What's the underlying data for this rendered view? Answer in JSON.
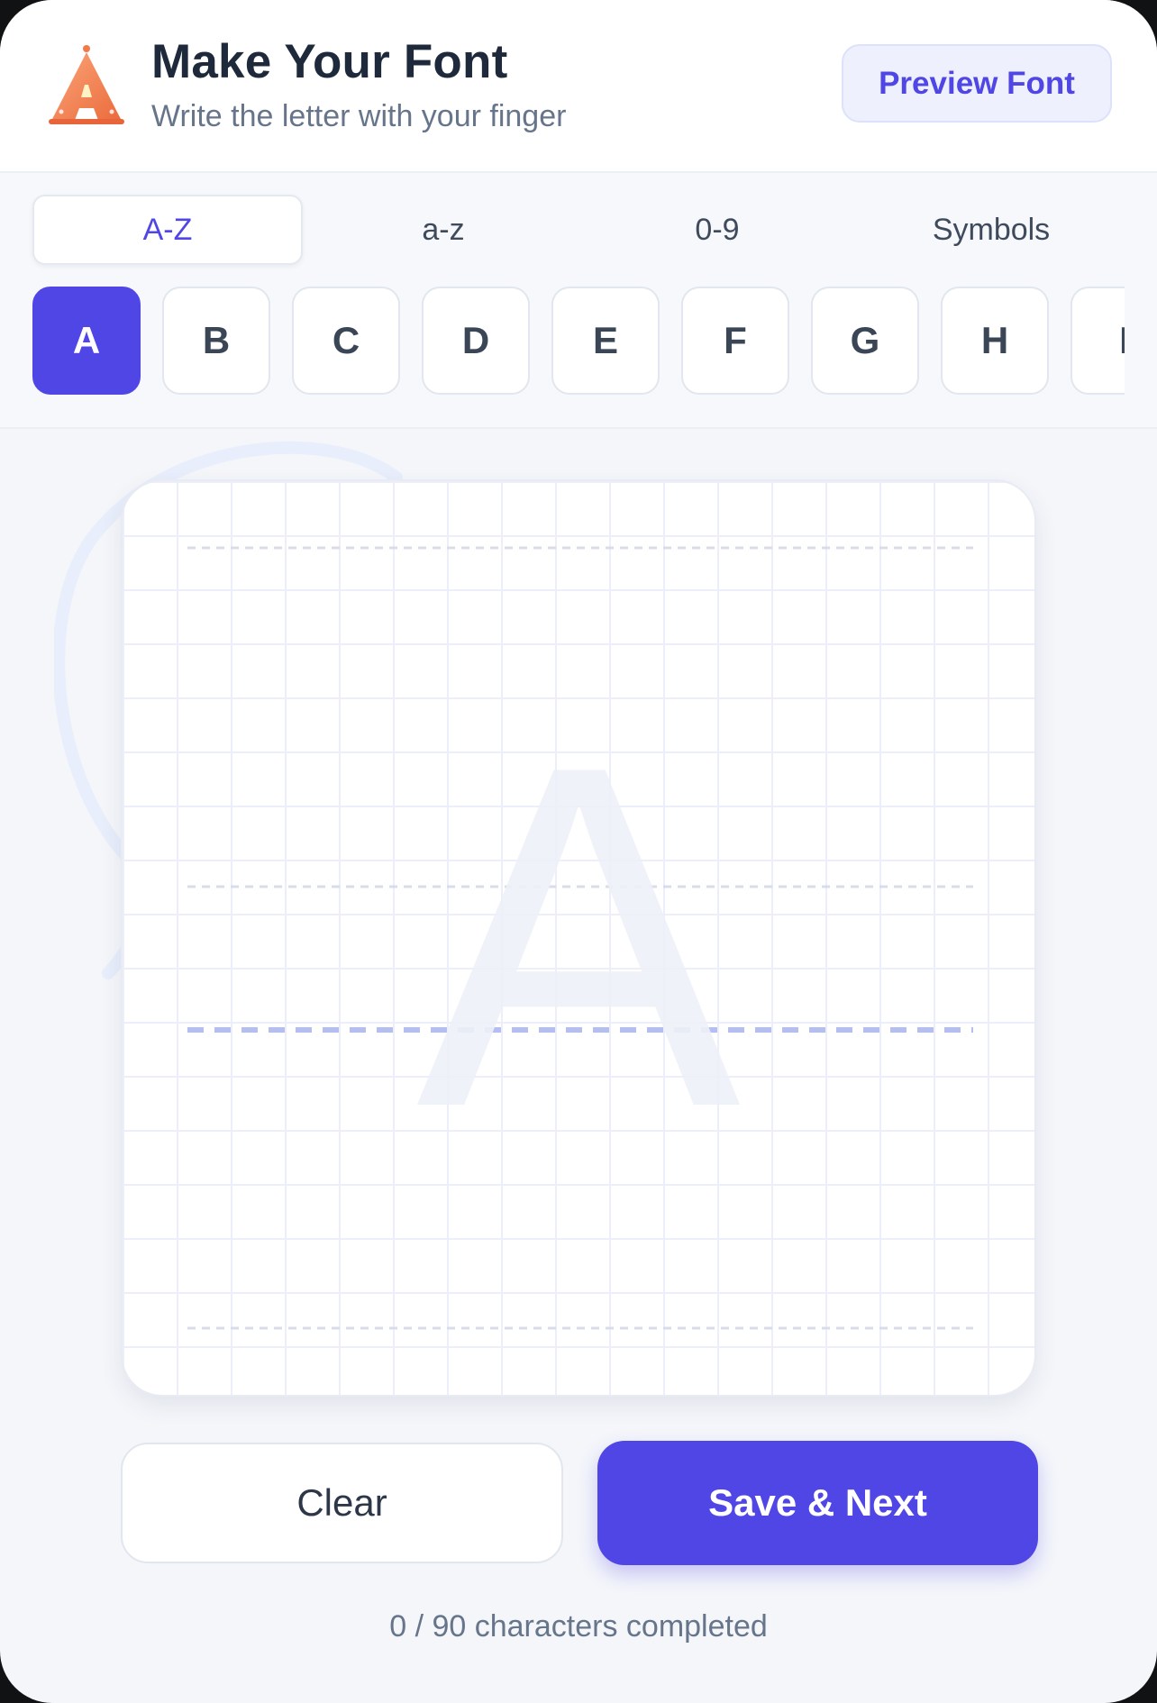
{
  "header": {
    "title": "Make Your Font",
    "subtitle": "Write the letter with your finger",
    "preview_label": "Preview Font",
    "logo_icon": "letter-a-cone-icon"
  },
  "tabs": [
    {
      "label": "A-Z",
      "active": true
    },
    {
      "label": "a-z",
      "active": false
    },
    {
      "label": "0-9",
      "active": false
    },
    {
      "label": "Symbols",
      "active": false
    }
  ],
  "letters": [
    {
      "label": "A",
      "active": true
    },
    {
      "label": "B",
      "active": false
    },
    {
      "label": "C",
      "active": false
    },
    {
      "label": "D",
      "active": false
    },
    {
      "label": "E",
      "active": false
    },
    {
      "label": "F",
      "active": false
    },
    {
      "label": "G",
      "active": false
    },
    {
      "label": "H",
      "active": false
    },
    {
      "label": "I",
      "active": false
    }
  ],
  "canvas": {
    "guide_letter": "A"
  },
  "actions": {
    "clear_label": "Clear",
    "save_label": "Save & Next"
  },
  "progress": {
    "text": "0 / 90 characters completed",
    "completed": 0,
    "total": 90
  },
  "colors": {
    "accent": "#4f46e5",
    "logo": "#f07a4a"
  }
}
